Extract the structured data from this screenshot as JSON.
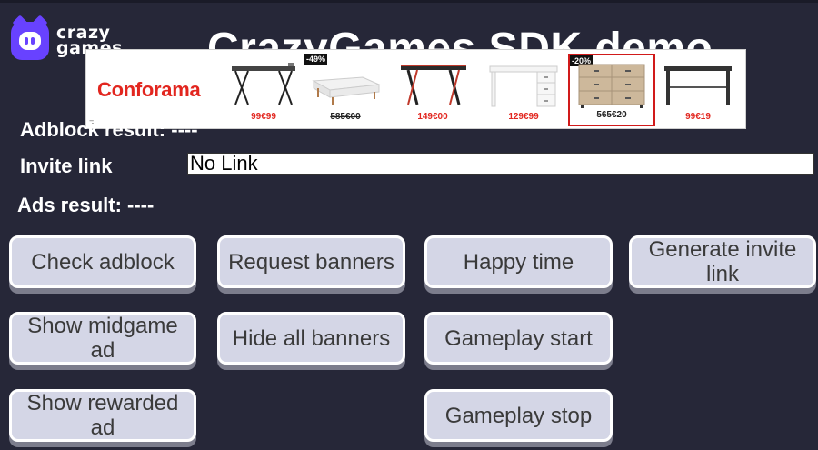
{
  "logo": {
    "line1": "crazy",
    "line2": "games"
  },
  "title": "CrazyGames SDK demo",
  "ad": {
    "brand": "Conforama",
    "corner_mark": "=",
    "products": [
      {
        "name": "desk-black-x-legs",
        "price": "99€99",
        "struck": false,
        "discount": ""
      },
      {
        "name": "bed-base-white",
        "price": "585€00",
        "struck": true,
        "discount": "-49%"
      },
      {
        "name": "gaming-desk-red",
        "price": "149€00",
        "struck": false,
        "discount": ""
      },
      {
        "name": "white-desk-drawers",
        "price": "129€99",
        "struck": false,
        "discount": ""
      },
      {
        "name": "wooden-chest-drawers",
        "price": "565€20",
        "struck": true,
        "discount": "-20%"
      },
      {
        "name": "black-desk",
        "price": "99€19",
        "struck": false,
        "discount": ""
      }
    ]
  },
  "adblock_result": {
    "label": "Adblock result: ----"
  },
  "invite": {
    "label": "Invite link",
    "value": "No Link"
  },
  "ads_result": {
    "label": "Ads result: ----"
  },
  "buttons": {
    "check_adblock": "Check adblock",
    "request_banners": "Request banners",
    "happy_time": "Happy time",
    "generate_invite": "Generate invite link",
    "show_midgame": "Show midgame ad",
    "hide_banners": "Hide all banners",
    "gameplay_start": "Gameplay start",
    "show_rewarded": "Show rewarded ad",
    "gameplay_stop": "Gameplay stop"
  },
  "colors": {
    "background": "#262738",
    "button_fill": "#d4d6e6",
    "button_shadow": "#7c7d8c",
    "brand_purple": "#6842ff",
    "ad_red": "#e2261f"
  }
}
